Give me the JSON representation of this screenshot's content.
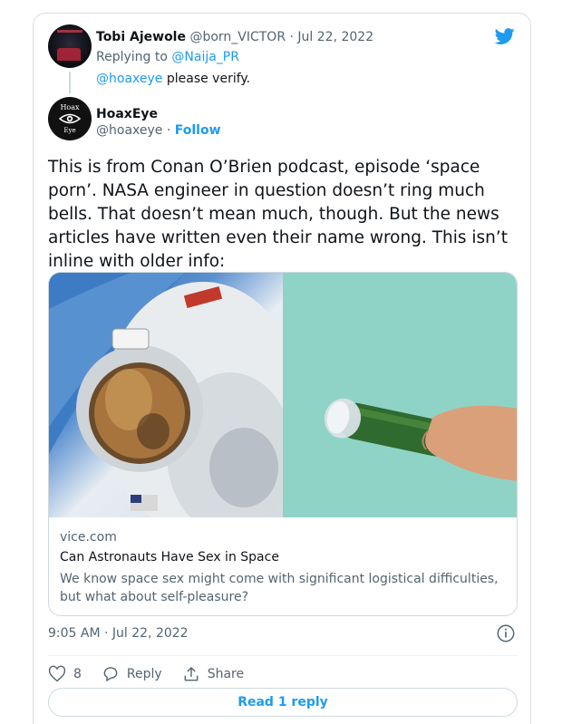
{
  "reply_tweet": {
    "author_name": "Tobi Ajewole",
    "author_handle": "@born_VICTOR",
    "separator": "·",
    "date": "Jul 22, 2022",
    "replying_prefix": "Replying to",
    "replying_to": "@Naija_PR",
    "mention": "@hoaxeye",
    "text": "please verify."
  },
  "main_tweet": {
    "author_name": "HoaxEye",
    "author_handle": "@hoaxeye",
    "separator": "·",
    "follow_label": "Follow",
    "avatar_text_top": "Hoax",
    "avatar_text_bottom": "Eye",
    "text": "This is from Conan O’Brien podcast, episode ‘space porn’. NASA engineer in question doesn’t ring much bells. That doesn’t mean much, though. But the news articles have written even their name wrong. This isn’t inline with older info:",
    "link_card": {
      "domain": "vice.com",
      "title": "Can Astronauts Have Sex in Space",
      "description": "We know space sex might come with significant logistical difficulties, but what about self-pleasure?"
    },
    "timestamp": "9:05 AM · Jul 22, 2022",
    "likes": "8",
    "reply_label": "Reply",
    "share_label": "Share",
    "read_replies_label": "Read 1 reply"
  },
  "colors": {
    "accent": "#1d9bf0",
    "muted": "#536471",
    "border": "#cfd9de"
  },
  "icons": [
    "twitter-bird-icon",
    "heart-icon",
    "reply-icon",
    "share-icon",
    "info-icon"
  ]
}
